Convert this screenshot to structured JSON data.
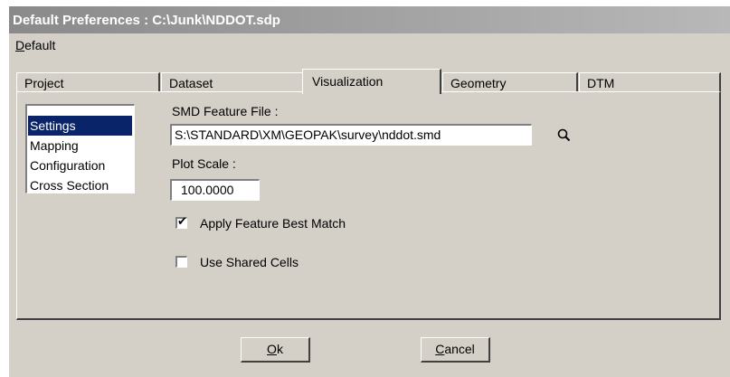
{
  "window": {
    "title": "Default Preferences : C:\\Junk\\NDDOT.sdp"
  },
  "menubar": {
    "default_first": "D",
    "default_rest": "efault"
  },
  "tabs": [
    {
      "label": "Project"
    },
    {
      "label": "Dataset"
    },
    {
      "label": "Visualization"
    },
    {
      "label": "Geometry"
    },
    {
      "label": "DTM"
    }
  ],
  "categories": {
    "items": [
      {
        "label": "Settings",
        "selected": true
      },
      {
        "label": "Mapping"
      },
      {
        "label": "Configuration"
      },
      {
        "label": "Cross Section"
      }
    ]
  },
  "settings": {
    "smd_label": "SMD Feature File :",
    "smd_value": "S:\\STANDARD\\XM\\GEOPAK\\survey\\nddot.smd",
    "plot_scale_label": "Plot Scale :",
    "plot_scale_value": "100.0000",
    "apply_best_match_label": "Apply Feature Best Match",
    "apply_best_match_checked": true,
    "shared_cells_label": "Use Shared Cells",
    "shared_cells_checked": false,
    "browse_icon": "magnifier-icon"
  },
  "buttons": {
    "ok_first": "O",
    "ok_rest": "k",
    "cancel_first": "C",
    "cancel_rest": "ancel"
  },
  "colors": {
    "selection": "#0a246a",
    "face": "#d4d0c8"
  }
}
